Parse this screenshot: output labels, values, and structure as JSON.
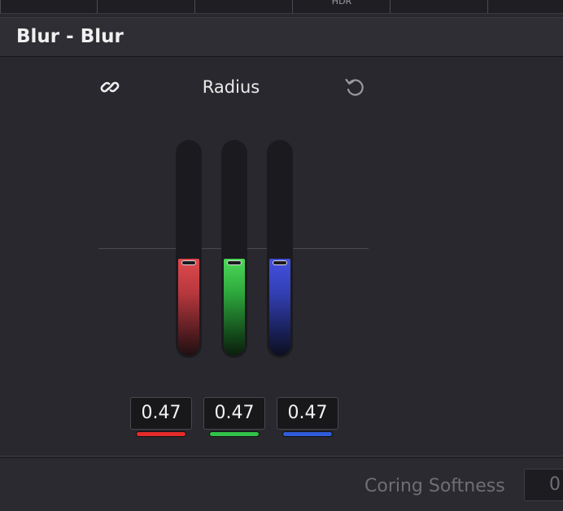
{
  "top_tabs": [
    {
      "label": ""
    },
    {
      "label": ""
    },
    {
      "label": ""
    },
    {
      "label": "HDR"
    },
    {
      "label": ""
    }
  ],
  "header": {
    "title": "Blur - Blur"
  },
  "radius": {
    "label": "Radius",
    "link_icon": "link-icon",
    "reset_icon": "reset-icon",
    "channels": [
      {
        "name": "red",
        "value": "0.47",
        "level": 0.47,
        "color": "#e32b2b"
      },
      {
        "name": "green",
        "value": "0.47",
        "level": 0.47,
        "color": "#31c149"
      },
      {
        "name": "blue",
        "value": "0.47",
        "level": 0.47,
        "color": "#2f5cd8"
      }
    ]
  },
  "coring": {
    "label": "Coring Softness",
    "value": "0"
  }
}
